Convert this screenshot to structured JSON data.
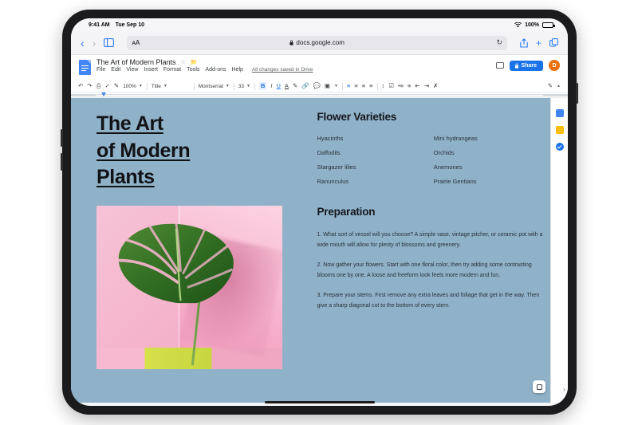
{
  "status_bar": {
    "time": "9:41 AM",
    "date": "Tue Sep 10",
    "wifi_icon": "wifi-icon",
    "battery_percent": "100%"
  },
  "safari": {
    "back_icon": "chevron-left-icon",
    "forward_icon": "chevron-right-icon",
    "sidebar_icon": "book-sidebar-icon",
    "text_size_label": "ᴀA",
    "lock_icon": "lock-icon",
    "url": "docs.google.com",
    "reload_icon": "reload-icon",
    "share_icon": "share-up-icon",
    "new_tab_icon": "plus-icon",
    "tabs_icon": "tabs-icon"
  },
  "docs": {
    "logo_icon": "google-docs-icon",
    "title": "The Art of Modern Plants",
    "star_icon": "star-outline-icon",
    "folder_icon": "move-to-folder-icon",
    "menus": [
      "File",
      "Edit",
      "View",
      "Insert",
      "Format",
      "Tools",
      "Add-ons",
      "Help"
    ],
    "save_state": "All changes saved in Drive",
    "comment_icon": "comment-icon",
    "share_label": "Share",
    "share_lock_icon": "lock-icon",
    "avatar_initial": "D"
  },
  "toolbar": {
    "undo_icon": "undo-icon",
    "redo_icon": "redo-icon",
    "print_icon": "print-icon",
    "spellcheck_icon": "spellcheck-icon",
    "paint_format_icon": "paint-format-icon",
    "zoom_value": "100%",
    "style_value": "Title",
    "font_value": "Montserrat",
    "font_size_value": "33",
    "bold_icon": "bold-icon",
    "italic_icon": "italic-icon",
    "underline_icon": "underline-icon",
    "text_color_icon": "text-color-icon",
    "highlight_icon": "highlight-icon",
    "link_icon": "insert-link-icon",
    "comment_add_icon": "add-comment-icon",
    "image_icon": "insert-image-icon",
    "align_left_icon": "align-left-icon",
    "align_center_icon": "align-center-icon",
    "align_right_icon": "align-right-icon",
    "align_justify_icon": "align-justify-icon",
    "line_spacing_icon": "line-spacing-icon",
    "checklist_icon": "checklist-icon",
    "bulleted_list_icon": "bulleted-list-icon",
    "numbered_list_icon": "numbered-list-icon",
    "indent_decrease_icon": "indent-decrease-icon",
    "indent_increase_icon": "indent-increase-icon",
    "clear_format_icon": "clear-formatting-icon",
    "edit_mode_icon": "edit-mode-icon",
    "collapse_icon": "chevron-up-icon"
  },
  "document": {
    "heading_lines": [
      "The Art",
      "of Modern",
      "Plants"
    ],
    "image_alt": "monstera-leaf-photo",
    "section_varieties_title": "Flower Varieties",
    "varieties": [
      "Hyacinths",
      "Mini hydrangeas",
      "Daffodils",
      "Orchids",
      "Stargazer lilies",
      "Anemones",
      "Ranunculus",
      "Prairie Gentians"
    ],
    "section_preparation_title": "Preparation",
    "paragraphs": [
      "1. What sort of vessel will you choose? A simple vase, vintage pitcher, or ceramic pot with a wide mouth will allow for plenty of blossoms and greenery.",
      "2. Now gather your flowers. Start with one floral color, then try adding some contrasting blooms one by one. A loose and freeform look feels more modern and fun.",
      "3. Prepare your stems. First remove any extra leaves and foliage that get in the way. Then give a sharp diagonal cut to the bottom of every stem."
    ],
    "background_color": "#8fb2c9"
  },
  "docs_sidebar": {
    "calendar_icon": "google-calendar-icon",
    "keep_icon": "google-keep-icon",
    "tasks_icon": "google-tasks-icon"
  },
  "floating": {
    "edit_fab_icon": "edit-fab-icon",
    "edge_chevron_icon": "chevron-right-icon"
  }
}
